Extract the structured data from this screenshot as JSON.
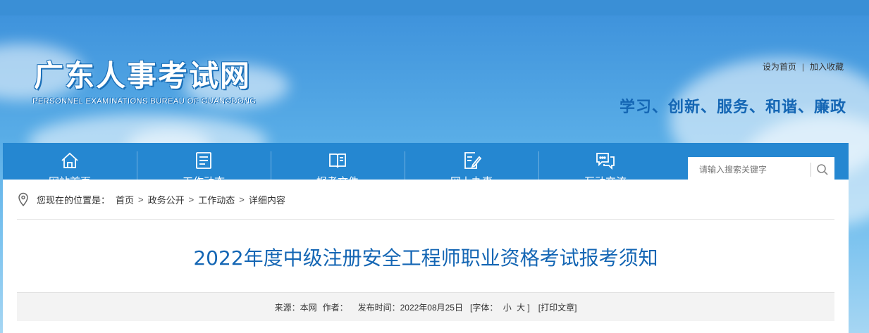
{
  "header": {
    "site_title": "广东人事考试网",
    "site_subtitle": "PERSONNEL EXAMINATIONS BUREAU OF GUANGDONG",
    "links": {
      "set_home": "设为首页",
      "separator": "|",
      "add_favorite": "加入收藏"
    },
    "slogan": "学习、创新、服务、和谐、廉政"
  },
  "nav": {
    "items": [
      {
        "label": "网站首页",
        "icon": "home-icon"
      },
      {
        "label": "工作动态",
        "icon": "news-list-icon"
      },
      {
        "label": "报考文件",
        "icon": "book-icon"
      },
      {
        "label": "网上办事",
        "icon": "edit-document-icon"
      },
      {
        "label": "互动交流",
        "icon": "chat-icon"
      }
    ],
    "search": {
      "placeholder": "请输入搜索关键字",
      "icon": "search-icon"
    }
  },
  "breadcrumb": {
    "icon": "location-pin-icon",
    "prefix": "您现在的位置是：",
    "items": [
      "首页",
      "政务公开",
      "工作动态",
      "详细内容"
    ],
    "arrow": ">"
  },
  "article": {
    "title": "2022年度中级注册安全工程师职业资格考试报考须知",
    "meta": {
      "source": "来源：本网",
      "author": "作者：",
      "published": "发布时间：2022年08月25日",
      "font_prefix": "[字体：",
      "font_small": "小",
      "font_large": "大",
      "font_suffix": "]",
      "print": "[打印文章]"
    }
  },
  "colors": {
    "topbar": "#3a8fd6",
    "nav": "#2587d1",
    "title_blue": "#1466b4"
  }
}
